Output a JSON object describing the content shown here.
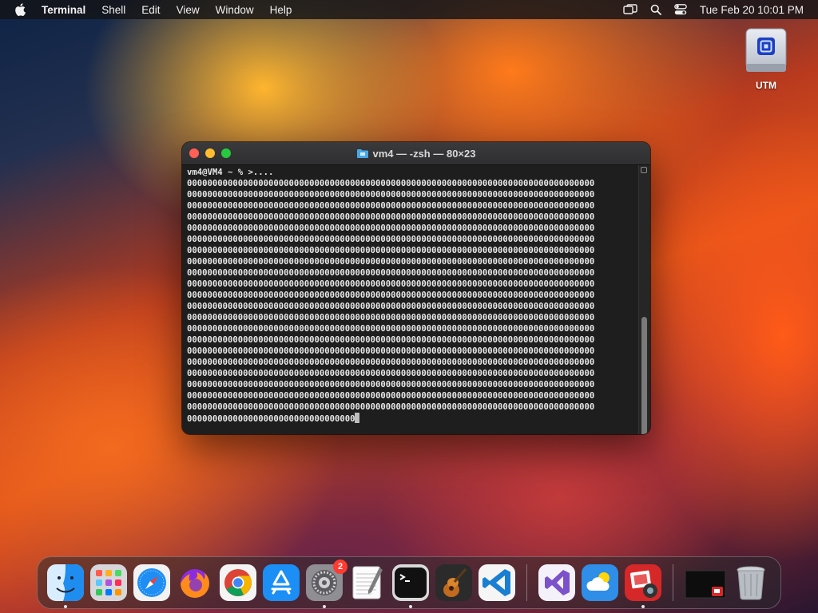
{
  "menubar": {
    "app_name": "Terminal",
    "items": [
      "Shell",
      "Edit",
      "View",
      "Window",
      "Help"
    ],
    "clock": "Tue Feb 20  10:01 PM"
  },
  "desktop": {
    "utm_label": "UTM"
  },
  "terminal": {
    "title": "vm4 — -zsh — 80×23",
    "prompt_line": "vm4@VM4 ~ % >....",
    "output_lines": [
      "00000000000000000000000000000000000000000000000000000000000000000000000000000000",
      "00000000000000000000000000000000000000000000000000000000000000000000000000000000",
      "00000000000000000000000000000000000000000000000000000000000000000000000000000000",
      "00000000000000000000000000000000000000000000000000000000000000000000000000000000",
      "00000000000000000000000000000000000000000000000000000000000000000000000000000000",
      "00000000000000000000000000000000000000000000000000000000000000000000000000000000",
      "00000000000000000000000000000000000000000000000000000000000000000000000000000000",
      "00000000000000000000000000000000000000000000000000000000000000000000000000000000",
      "00000000000000000000000000000000000000000000000000000000000000000000000000000000",
      "00000000000000000000000000000000000000000000000000000000000000000000000000000000",
      "00000000000000000000000000000000000000000000000000000000000000000000000000000000",
      "00000000000000000000000000000000000000000000000000000000000000000000000000000000",
      "00000000000000000000000000000000000000000000000000000000000000000000000000000000",
      "00000000000000000000000000000000000000000000000000000000000000000000000000000000",
      "00000000000000000000000000000000000000000000000000000000000000000000000000000000",
      "00000000000000000000000000000000000000000000000000000000000000000000000000000000",
      "00000000000000000000000000000000000000000000000000000000000000000000000000000000",
      "00000000000000000000000000000000000000000000000000000000000000000000000000000000",
      "00000000000000000000000000000000000000000000000000000000000000000000000000000000",
      "00000000000000000000000000000000000000000000000000000000000000000000000000000000",
      "00000000000000000000000000000000000000000000000000000000000000000000000000000000"
    ],
    "last_line": "000000000000000000000000000000000"
  },
  "dock": {
    "settings_badge": "2",
    "apps": [
      "finder-icon",
      "launchpad-icon",
      "safari-icon",
      "firefox-icon",
      "chrome-icon",
      "app-store-icon",
      "system-settings-icon",
      "textedit-icon",
      "terminal-icon",
      "garageband-icon",
      "vscode-icon",
      "visual-studio-icon",
      "weather-icon",
      "photo-booth-icon",
      "window-thumbnail-icon",
      "trash-icon"
    ]
  }
}
